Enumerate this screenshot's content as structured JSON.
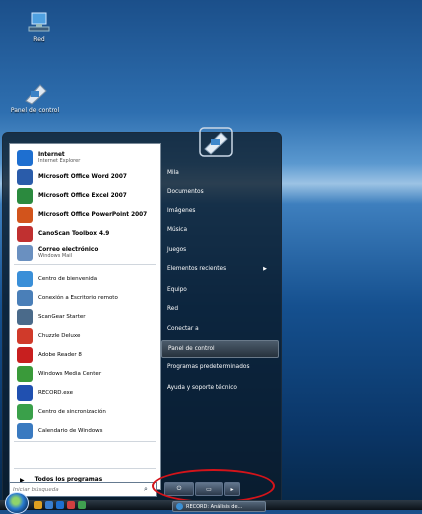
{
  "desktop": {
    "icons": [
      {
        "label": "Red",
        "icon": "network-computer-icon"
      },
      {
        "label": "Panel de control",
        "icon": "control-panel-icon"
      }
    ]
  },
  "start_menu": {
    "left_items": [
      {
        "title": "Internet",
        "subtitle": "Internet Explorer",
        "bold": true,
        "icon": "internet-explorer-icon",
        "color": "#1e6fd0"
      },
      {
        "title": "Microsoft Office Word 2007",
        "subtitle": "",
        "bold": true,
        "icon": "word-icon",
        "color": "#2a5caa"
      },
      {
        "title": "Microsoft Office Excel 2007",
        "subtitle": "",
        "bold": true,
        "icon": "excel-icon",
        "color": "#2b8a3e"
      },
      {
        "title": "Microsoft Office PowerPoint 2007",
        "subtitle": "",
        "bold": true,
        "icon": "powerpoint-icon",
        "color": "#d2541c"
      },
      {
        "title": "CanoScan Toolbox 4.9",
        "subtitle": "",
        "bold": true,
        "icon": "scanner-icon",
        "color": "#c03030"
      },
      {
        "title": "Correo electrónico",
        "subtitle": "Windows Mail",
        "bold": true,
        "icon": "mail-icon",
        "color": "#6a90c0"
      },
      {
        "title": "Centro de bienvenida",
        "subtitle": "",
        "bold": false,
        "icon": "welcome-center-icon",
        "color": "#3a8fd8"
      },
      {
        "title": "Conexión a Escritorio remoto",
        "subtitle": "",
        "bold": false,
        "icon": "remote-desktop-icon",
        "color": "#4a7fb8"
      },
      {
        "title": "ScanGear Starter",
        "subtitle": "",
        "bold": false,
        "icon": "scangear-icon",
        "color": "#4a6a8a"
      },
      {
        "title": "Chuzzle Deluxe",
        "subtitle": "",
        "bold": false,
        "icon": "chuzzle-icon",
        "color": "#d03a2a"
      },
      {
        "title": "Adobe Reader 8",
        "subtitle": "",
        "bold": false,
        "icon": "adobe-reader-icon",
        "color": "#c81f1f"
      },
      {
        "title": "Windows Media Center",
        "subtitle": "",
        "bold": false,
        "icon": "media-center-icon",
        "color": "#3a9a3a"
      },
      {
        "title": "RECORD.exe",
        "subtitle": "",
        "bold": false,
        "icon": "record-app-icon",
        "color": "#2050b0"
      },
      {
        "title": "Centro de sincronización",
        "subtitle": "",
        "bold": false,
        "icon": "sync-center-icon",
        "color": "#3aa04a"
      },
      {
        "title": "Calendario de Windows",
        "subtitle": "",
        "bold": false,
        "icon": "calendar-icon",
        "color": "#3a7ac0"
      }
    ],
    "all_programs": "Todos los programas",
    "search_placeholder": "Iniciar búsqueda",
    "right_items": [
      {
        "label": "Mila"
      },
      {
        "label": "Documentos"
      },
      {
        "label": "Imágenes"
      },
      {
        "label": "Música"
      },
      {
        "label": "Juegos"
      },
      {
        "label": "Elementos recientes",
        "has_submenu": true
      },
      {
        "label": "Equipo"
      },
      {
        "label": "Red"
      },
      {
        "label": "Conectar a"
      },
      {
        "label": "Panel de control",
        "highlighted": true
      },
      {
        "label": "Programas predeterminados"
      },
      {
        "label": "Ayuda y soporte técnico"
      }
    ],
    "annotation_color": "#d4141a"
  },
  "taskbar": {
    "task_button": "RECORD: Análisis de..."
  }
}
